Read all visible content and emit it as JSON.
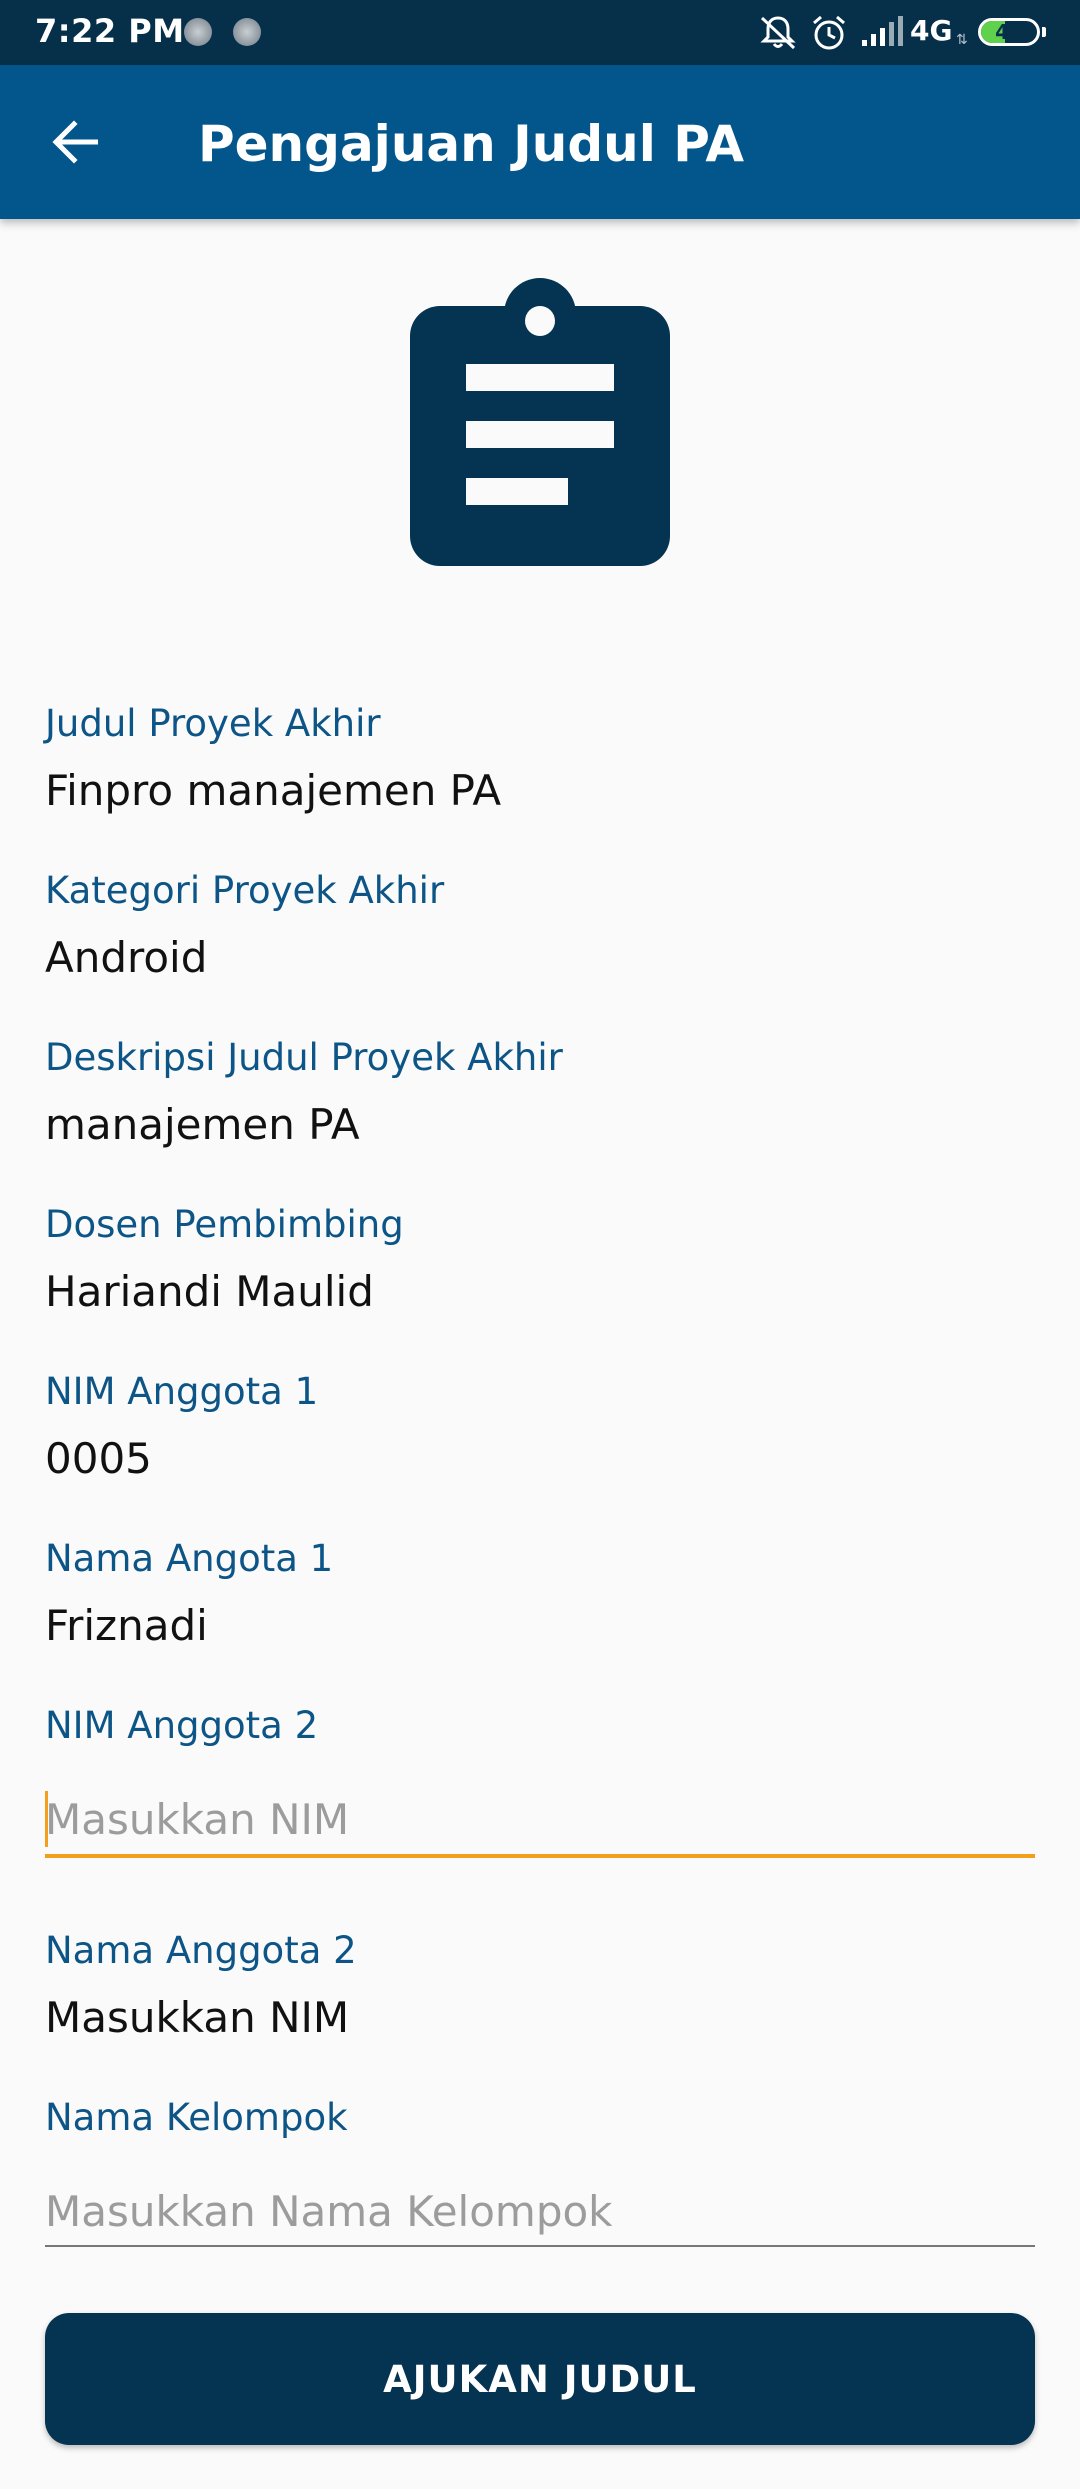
{
  "status_bar": {
    "time": "7:22 PM",
    "network": "4G",
    "battery": "42",
    "icons": [
      "notification-dot-icon",
      "notification-dot-icon",
      "mute-icon",
      "alarm-icon",
      "signal-icon",
      "battery-icon"
    ]
  },
  "app_bar": {
    "title": "Pengajuan Judul PA",
    "back_icon": "arrow-back-icon"
  },
  "header_icon": "clipboard-icon",
  "form": {
    "judul": {
      "label": "Judul Proyek Akhir",
      "value": "Finpro manajemen PA"
    },
    "kategori": {
      "label": "Kategori Proyek Akhir",
      "value": "Android"
    },
    "deskripsi": {
      "label": "Deskripsi Judul Proyek Akhir",
      "value": "manajemen PA"
    },
    "dosen": {
      "label": "Dosen Pembimbing",
      "value": "Hariandi Maulid"
    },
    "nim1": {
      "label": "NIM Anggota 1",
      "value": "0005"
    },
    "nama1": {
      "label": "Nama Angota 1",
      "value": "Friznadi"
    },
    "nim2": {
      "label": "NIM Anggota 2",
      "value": "",
      "placeholder": "Masukkan NIM"
    },
    "nama2": {
      "label": "Nama Anggota 2",
      "value": "Masukkan NIM"
    },
    "kelompok": {
      "label": "Nama Kelompok",
      "value": "",
      "placeholder": "Masukkan Nama Kelompok"
    }
  },
  "submit_label": "AJUKAN JUDUL",
  "colors": {
    "status_bar": "#062f4a",
    "app_bar": "#03568b",
    "label": "#0d5587",
    "focus_accent": "#f29f1e",
    "button": "#053453",
    "icon": "#053453"
  }
}
